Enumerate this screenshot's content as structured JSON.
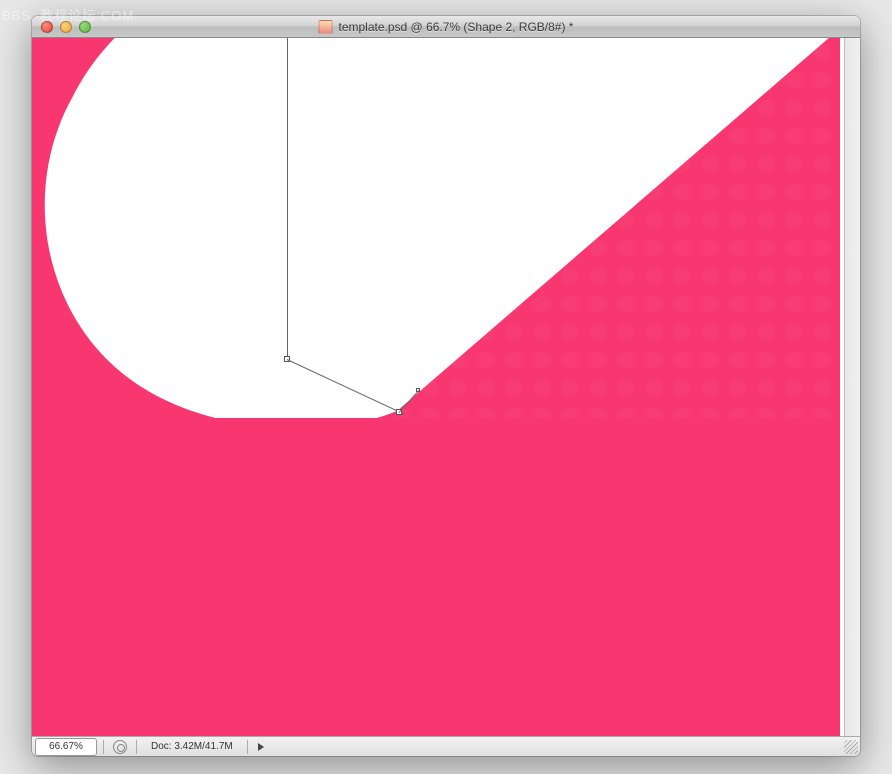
{
  "watermark": "BBS. 教程论坛 COM",
  "window": {
    "title": "template.psd @ 66.7% (Shape 2, RGB/8#) *"
  },
  "status": {
    "zoom": "66.67%",
    "doc_info": "Doc: 3.42M/41.7M"
  },
  "colors": {
    "pink": "#f8366f"
  }
}
